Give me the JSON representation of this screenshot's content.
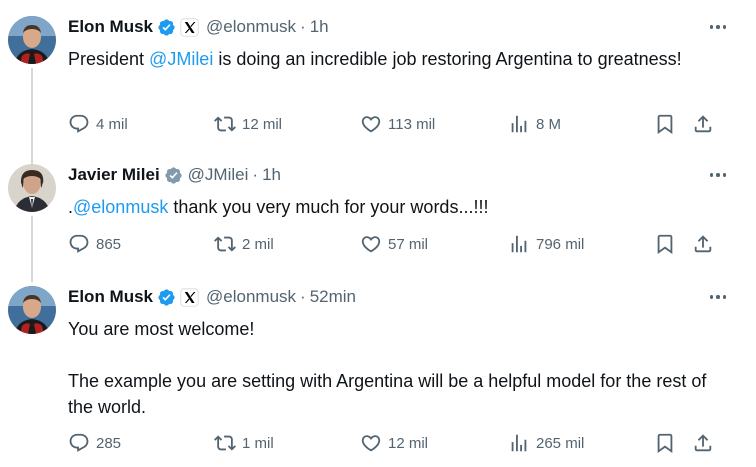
{
  "tweets": [
    {
      "author": "Elon Musk",
      "handle": "@elonmusk",
      "separator": "·",
      "time": "1h",
      "text_before": "President ",
      "mention": "@JMilei",
      "text_after": " is doing an incredible job restoring Argentina to greatness!",
      "replies": "4 mil",
      "retweets": "12 mil",
      "likes": "113 mil",
      "views": "8 M"
    },
    {
      "author": "Javier Milei",
      "handle": "@JMilei",
      "separator": "·",
      "time": "1h",
      "text_before": ".",
      "mention": "@elonmusk",
      "text_after": " thank you very much for your words...!!!",
      "replies": "865",
      "retweets": "2 mil",
      "likes": "57 mil",
      "views": "796 mil"
    },
    {
      "author": "Elon Musk",
      "handle": "@elonmusk",
      "separator": "·",
      "time": "52min",
      "line1": "You are most welcome!",
      "line2": "The example you are setting with Argentina will be a helpful model for the rest of the world.",
      "replies": "285",
      "retweets": "1 mil",
      "likes": "12 mil",
      "views": "265 mil"
    }
  ],
  "colors": {
    "verified": "#1d9bf0",
    "verified_gray": "#829aab",
    "mention": "#1d9bf0",
    "secondary_text": "#536471",
    "thread_line": "#cfd9de"
  },
  "icons": [
    "verified-badge-icon",
    "x-affiliation-icon",
    "more-icon",
    "reply-icon",
    "retweet-icon",
    "like-icon",
    "views-icon",
    "bookmark-icon",
    "share-icon"
  ]
}
